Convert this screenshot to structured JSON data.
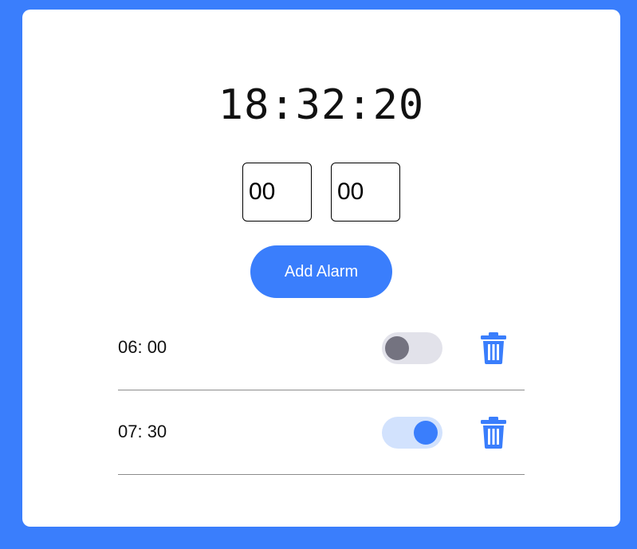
{
  "clock": {
    "time": "18:32:20"
  },
  "inputs": {
    "hour_value": "00",
    "minute_value": "00"
  },
  "add_button": {
    "label": "Add Alarm"
  },
  "alarms": [
    {
      "time": "06: 00",
      "enabled": false
    },
    {
      "time": "07: 30",
      "enabled": true
    }
  ],
  "colors": {
    "accent": "#3a7efc",
    "toggle_off_track": "#e2e2ea",
    "toggle_off_knob": "#747380",
    "toggle_on_track": "#d2e2fd"
  },
  "icons": {
    "delete": "trash-icon"
  }
}
